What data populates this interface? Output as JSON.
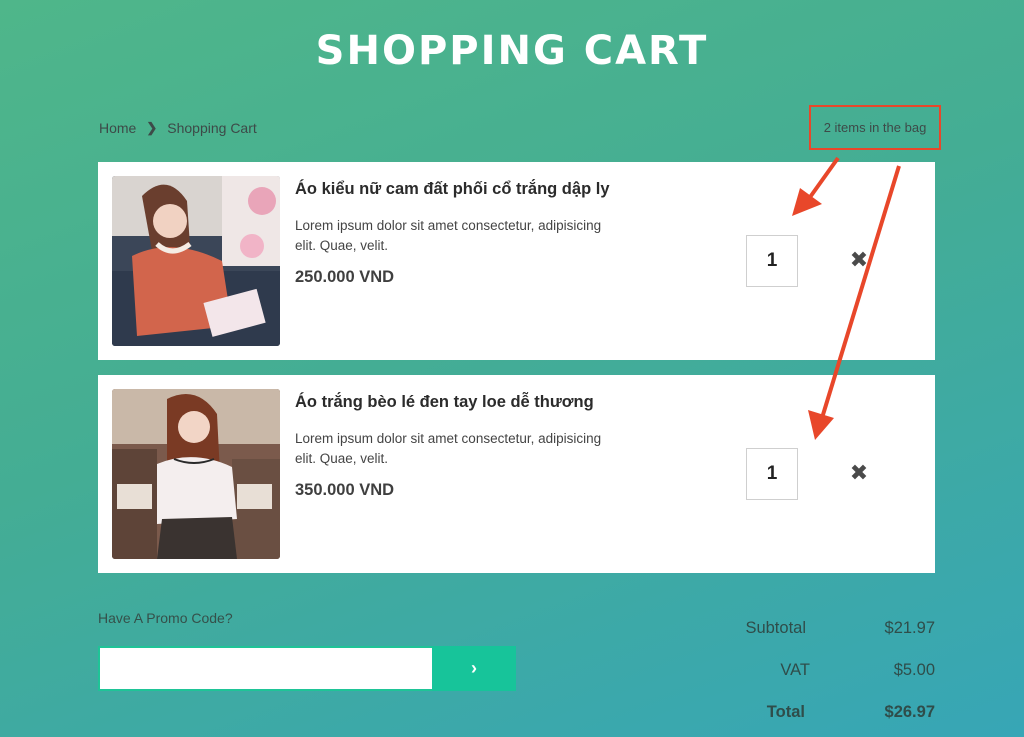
{
  "header": {
    "title": "SHOPPING CART"
  },
  "breadcrumb": {
    "home": "Home",
    "separator": "❯",
    "current": "Shopping Cart"
  },
  "bag": {
    "count_text": "2 items in the bag"
  },
  "items": [
    {
      "name": "Áo kiểu nữ cam đất phối cổ trắng dập ly",
      "description": "Lorem ipsum dolor sit amet consectetur, adipisicing elit. Quae, velit.",
      "price": "250.000 VND",
      "quantity": "1",
      "remove_icon": "✖"
    },
    {
      "name": "Áo trắng bèo lé đen tay loe dễ thương",
      "description": "Lorem ipsum dolor sit amet consectetur, adipisicing elit. Quae, velit.",
      "price": "350.000 VND",
      "quantity": "1",
      "remove_icon": "✖"
    }
  ],
  "promo": {
    "label": "Have A Promo Code?",
    "value": "",
    "submit_icon": "›"
  },
  "totals": {
    "subtotal_label": "Subtotal",
    "subtotal_value": "$21.97",
    "vat_label": "VAT",
    "vat_value": "$5.00",
    "total_label": "Total",
    "total_value": "$26.97"
  },
  "annotation": {
    "color": "#e8472a"
  }
}
